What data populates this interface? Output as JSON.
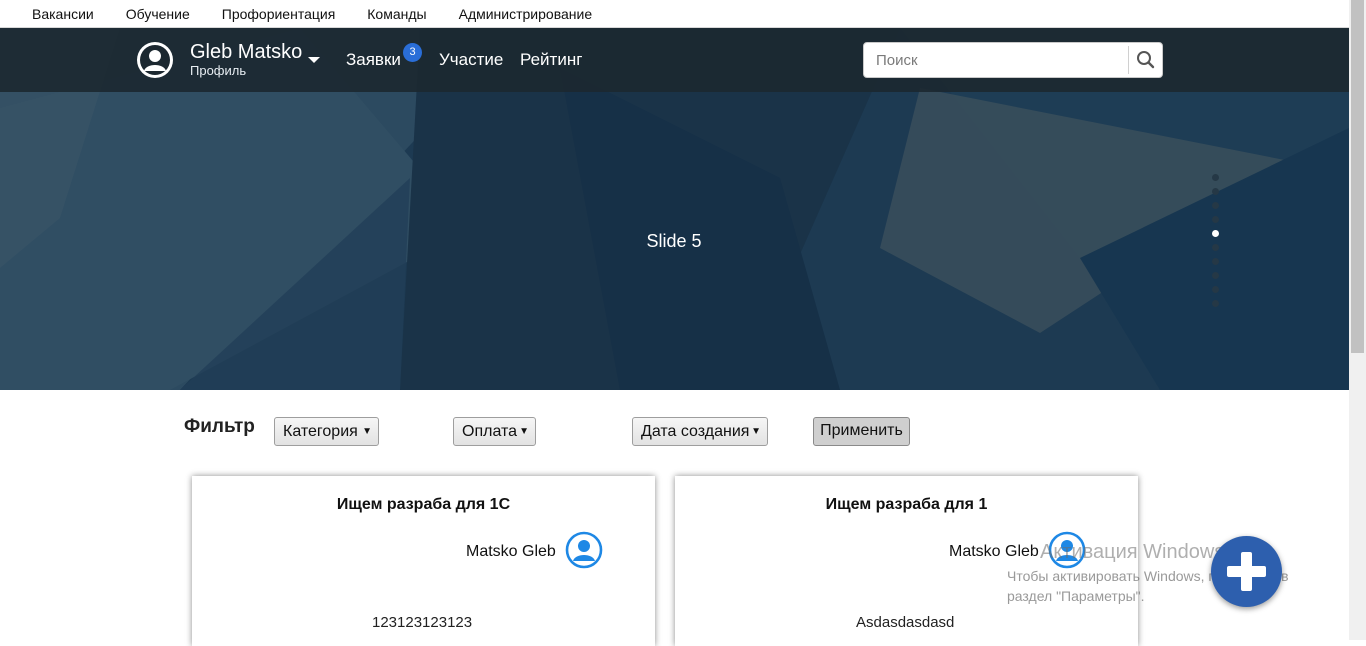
{
  "top_menu": {
    "items": [
      "Вакансии",
      "Обучение",
      "Профориентация",
      "Команды",
      "Администрирование"
    ]
  },
  "navbar": {
    "profile_name": "Gleb Matsko",
    "profile_subtitle": "Профиль",
    "links": {
      "requests": "Заявки",
      "participation": "Участие",
      "rating": "Рейтинг"
    },
    "requests_badge": "3",
    "search": {
      "placeholder": "Поиск",
      "value": ""
    }
  },
  "slider": {
    "label": "Slide 5",
    "dot_count": 10,
    "active_index": 4
  },
  "filter": {
    "title": "Фильтр",
    "category_label": "Категория",
    "payment_label": "Оплата",
    "date_label": "Дата создания",
    "apply_label": "Применить"
  },
  "cards": [
    {
      "title": "Ищем разраба для 1С",
      "author": "Matsko Gleb",
      "description": "123123123123"
    },
    {
      "title": "Ищем разраба для 1",
      "author": "Matsko Gleb",
      "description": "Asdasdasdasd"
    }
  ],
  "watermark": {
    "title": "Активация Windows",
    "line1": "Чтобы активировать Windows, перейдите в",
    "line2": "раздел \"Параметры\"."
  },
  "colors": {
    "navbar_bg": "#1c2830",
    "accent_blue": "#2a6ed8",
    "fab": "#2d5fae",
    "user_icon": "#1e88e5"
  },
  "icons": {
    "avatar": "user-circle-icon",
    "search": "search-icon",
    "fab": "plus-icon"
  }
}
